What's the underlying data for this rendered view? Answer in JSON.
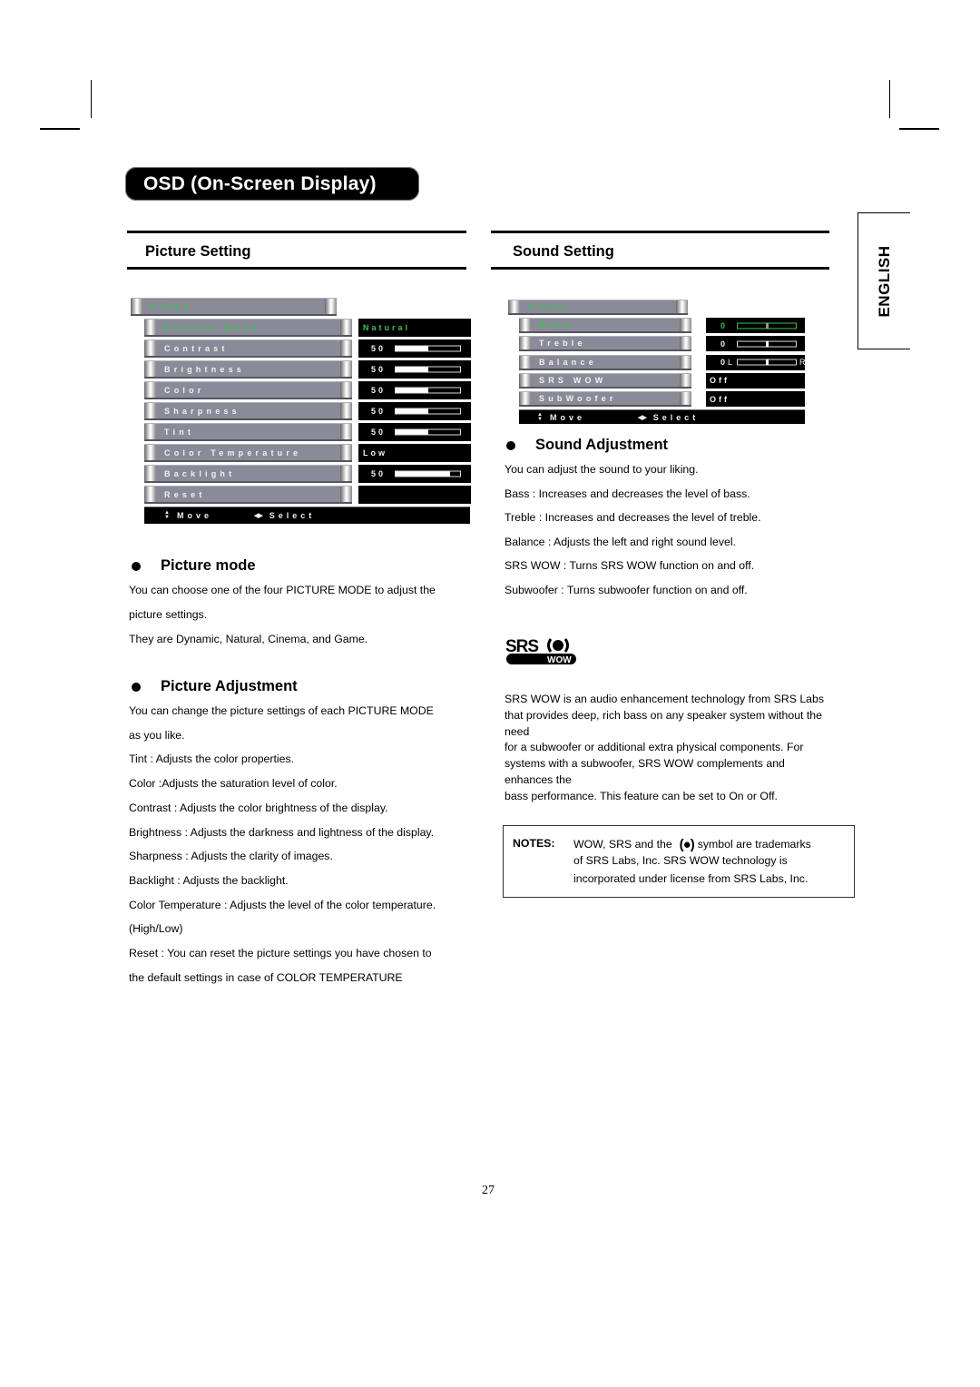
{
  "page": {
    "title": "OSD (On-Screen Display)",
    "language_tab": "ENGLISH",
    "page_number": "27"
  },
  "picture_section": {
    "heading": "Picture Setting",
    "osd": {
      "menu_title": "Video",
      "items": [
        {
          "label": "Picture Mode",
          "value": "Natural",
          "slider": null,
          "selected": true
        },
        {
          "label": "Contrast",
          "value": "50",
          "slider": 0.5,
          "selected": false
        },
        {
          "label": "Brightness",
          "value": "50",
          "slider": 0.5,
          "selected": false
        },
        {
          "label": "Color",
          "value": "50",
          "slider": 0.5,
          "selected": false
        },
        {
          "label": "Sharpness",
          "value": "50",
          "slider": 0.5,
          "selected": false
        },
        {
          "label": "Tint",
          "value": "50",
          "slider": 0.5,
          "selected": false
        },
        {
          "label": "Color Temperature",
          "value": "Low",
          "slider": null,
          "selected": false
        },
        {
          "label": "Backlight",
          "value": "50",
          "slider": 0.85,
          "selected": false
        },
        {
          "label": "Reset",
          "value": "",
          "slider": null,
          "selected": false
        }
      ],
      "footer_move": "Move",
      "footer_select": "Select"
    },
    "picture_mode": {
      "heading": "Picture mode",
      "lines": [
        "You can choose one of the four PICTURE MODE to adjust the",
        "picture settings.",
        "They are Dynamic, Natural, Cinema, and Game."
      ]
    },
    "picture_adjustment": {
      "heading": "Picture Adjustment",
      "lines": [
        "You can change the picture settings of each PICTURE MODE",
        "as you like.",
        "Tint : Adjusts the color properties.",
        "Color :Adjusts the saturation level of color.",
        "Contrast : Adjusts the color brightness of the display.",
        "Brightness : Adjusts the darkness and lightness of the display.",
        "Sharpness : Adjusts the clarity of images.",
        "Backlight : Adjusts the backlight.",
        "Color Temperature : Adjusts the level of the color temperature.",
        "(High/Low)",
        "Reset : You can reset the picture settings you have chosen to",
        "the default settings in case of COLOR TEMPERATURE"
      ]
    }
  },
  "sound_section": {
    "heading": "Sound Setting",
    "osd": {
      "menu_title": "Audio",
      "items": [
        {
          "label": "Bass",
          "value": "0",
          "slider": 0.5,
          "selected": true,
          "lr": false
        },
        {
          "label": "Treble",
          "value": "0",
          "slider": 0.5,
          "selected": false,
          "lr": false
        },
        {
          "label": "Balance",
          "value": "0",
          "slider": 0.5,
          "selected": false,
          "lr": true,
          "left": "L",
          "right": "R"
        },
        {
          "label": "SRS WOW",
          "value": "Off",
          "slider": null,
          "selected": false
        },
        {
          "label": "SubWoofer",
          "value": "Off",
          "slider": null,
          "selected": false
        }
      ],
      "footer_move": "Move",
      "footer_select": "Select"
    },
    "sound_adjustment": {
      "heading": "Sound Adjustment",
      "lines": [
        "You can adjust the sound to your liking.",
        "Bass : Increases and decreases the level of bass.",
        "Treble : Increases and decreases the level of treble.",
        "Balance : Adjusts the left and right sound level.",
        "SRS WOW : Turns SRS WOW function on and off.",
        "Subwoofer : Turns subwoofer function on and off."
      ]
    },
    "srs_logo": {
      "top": "SRS",
      "bottom": "WOW"
    },
    "srs_description": [
      "SRS WOW is an audio enhancement technology from SRS Labs",
      "that provides deep, rich bass on any speaker system without the",
      "need",
      "for a subwoofer or additional extra physical components. For",
      "systems with a subwoofer, SRS WOW complements and",
      "enhances the",
      "bass performance. This feature can be set to On or Off."
    ],
    "notes": {
      "label": "NOTES:",
      "line1_a": "WOW, SRS and the",
      "line1_b": "symbol are trademarks",
      "line2": "of SRS Labs, Inc. SRS WOW technology is",
      "line3": "incorporated under license from SRS Labs, Inc."
    }
  },
  "colors": {
    "osd_bar": "#8a8a98",
    "osd_highlight": "#3fbf55",
    "osd_value_bg": "#000000"
  }
}
